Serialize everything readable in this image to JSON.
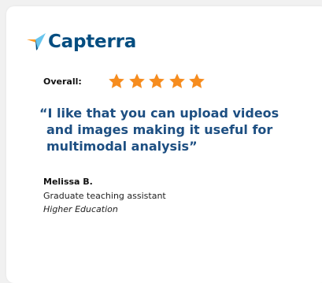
{
  "brand": {
    "name": "Capterra",
    "logo_icon": "capterra-arrow-icon",
    "colors": {
      "text": "#044d80",
      "orange": "#ff9d28",
      "blue": "#68c5ed",
      "navy": "#044d80",
      "red": "#e54747"
    }
  },
  "rating": {
    "label": "Overall:",
    "stars": 5,
    "max": 5,
    "star_color": "#f68c1e"
  },
  "review": {
    "quote": "“I like that you can upload videos and images making it useful for multimodal analysis”"
  },
  "reviewer": {
    "name": "Melissa B.",
    "role": "Graduate teaching assistant",
    "industry": "Higher Education"
  }
}
